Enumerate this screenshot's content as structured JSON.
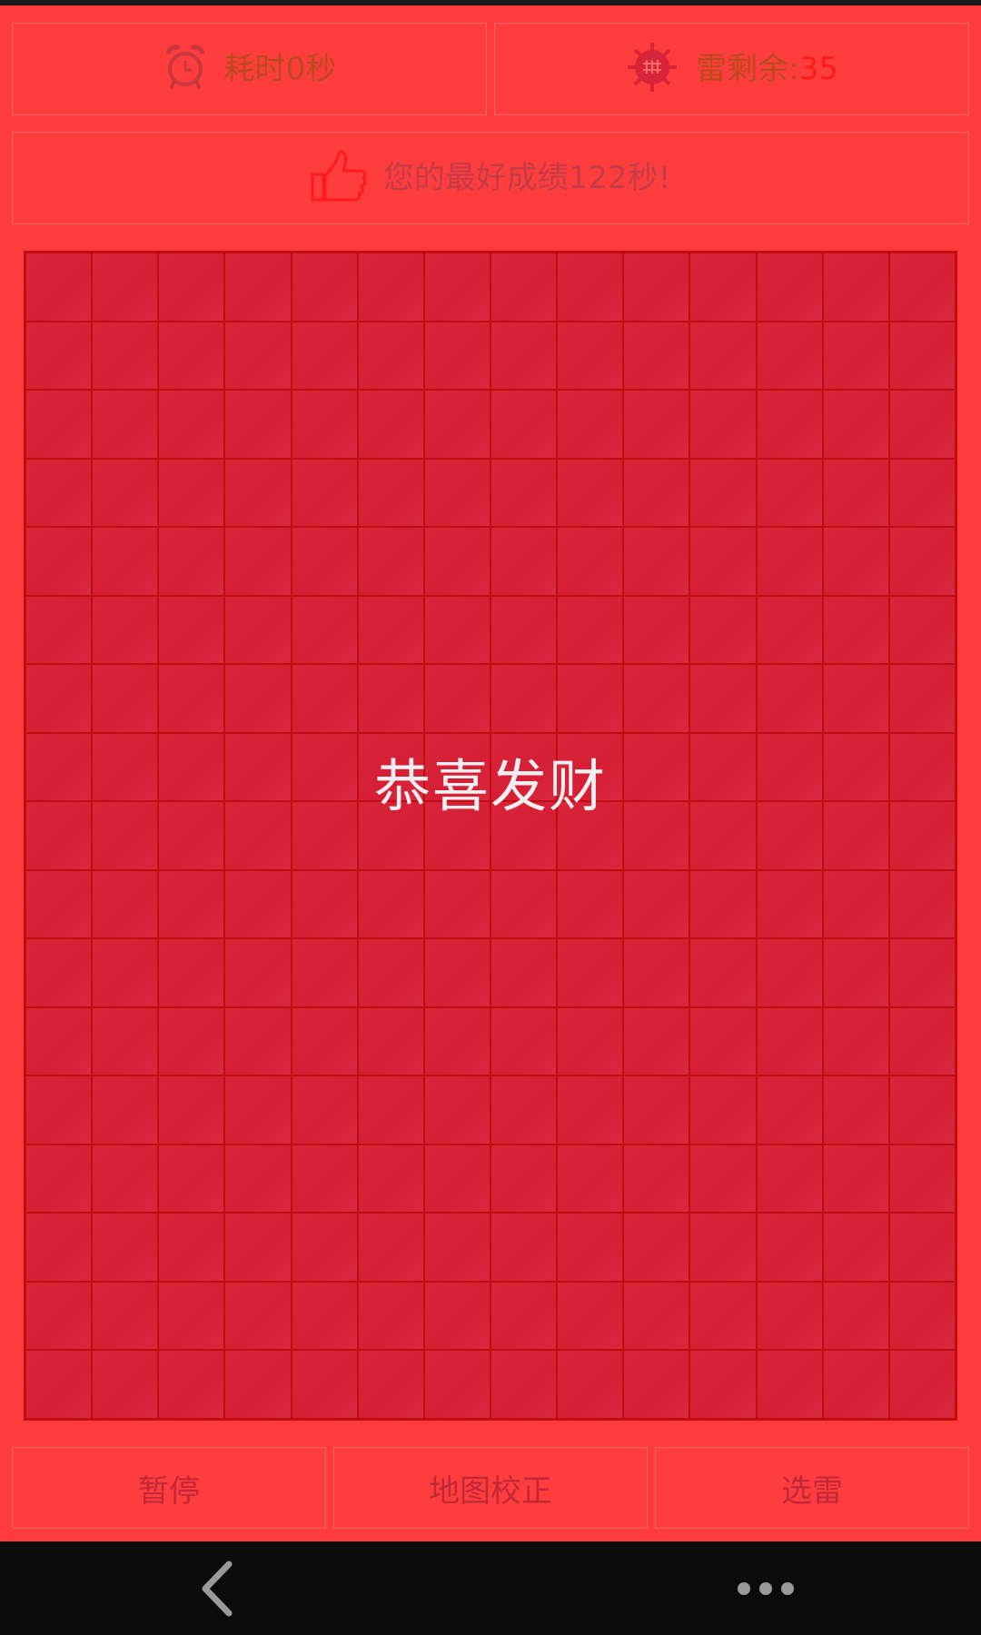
{
  "header": {
    "timer": {
      "label": "耗时",
      "value": "0",
      "unit": "秒",
      "icon": "alarm-clock-icon"
    },
    "mines": {
      "label": "雷剩余:",
      "value": "35",
      "icon": "mine-icon"
    },
    "best": {
      "text": "您的最好成绩122秒!",
      "icon": "thumbs-up-icon"
    }
  },
  "board": {
    "rows": 17,
    "cols": 14,
    "message": "恭喜发财"
  },
  "controls": {
    "pause": "暂停",
    "map_fix": "地图校正",
    "select_mine": "选雷"
  },
  "navbar": {
    "back_icon": "back-chevron-icon",
    "more_icon": "more-dots-icon"
  },
  "colors": {
    "background": "#ff3a3a",
    "cell": "#d8243a",
    "grid_line": "#c00e10",
    "accent_number": "#ff1a1a"
  }
}
